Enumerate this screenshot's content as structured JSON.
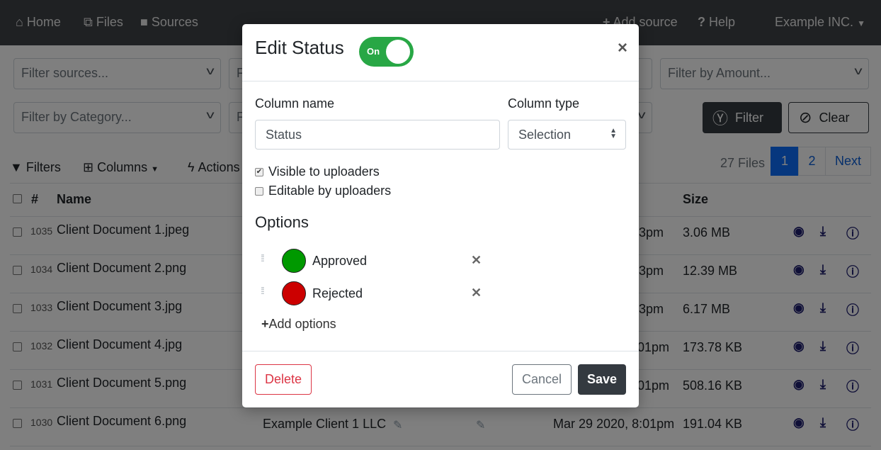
{
  "nav": {
    "home": "Home",
    "files": "Files",
    "sources": "Sources",
    "add_source": "Add source",
    "help": "Help",
    "org": "Example INC."
  },
  "filters": {
    "sources": "Filter sources...",
    "amount": "Filter by Amount...",
    "category": "Filter by Category...",
    "partial_1": "F",
    "partial_2": "F",
    "filter_btn": "Filter",
    "clear_btn": "Clear"
  },
  "toolbar": {
    "filters": "Filters",
    "columns": "Columns",
    "actions": "Actions"
  },
  "pagination": {
    "count": "27 Files",
    "pages": [
      "1",
      "2"
    ],
    "next": "Next",
    "current": 1
  },
  "table": {
    "headers": {
      "num": "#",
      "name": "Name",
      "size": "Size"
    },
    "rows": [
      {
        "id": "1035",
        "name": "Client Document 1.jpeg",
        "date": "3pm",
        "size": "3.06 MB"
      },
      {
        "id": "1034",
        "name": "Client Document 2.png",
        "date": "3pm",
        "size": "12.39 MB"
      },
      {
        "id": "1033",
        "name": "Client Document 3.jpg",
        "date": "3pm",
        "size": "6.17 MB"
      },
      {
        "id": "1032",
        "name": "Client Document 4.jpg",
        "date": ":01pm",
        "size": "173.78 KB"
      },
      {
        "id": "1031",
        "name": "Client Document 5.png",
        "date": ":01pm",
        "size": "508.16 KB"
      },
      {
        "id": "1030",
        "name": "Client Document 6.png",
        "client": "Example Client 1 LLC",
        "date": "Mar 29 2020, 8:01pm",
        "size": "191.04 KB"
      }
    ]
  },
  "modal": {
    "title": "Edit Status",
    "toggle": "On",
    "toggle_on": true,
    "column_name_label": "Column name",
    "column_name_value": "Status",
    "column_type_label": "Column type",
    "column_type_value": "Selection",
    "visible_label": "Visible to uploaders",
    "visible_checked": true,
    "editable_label": "Editable by uploaders",
    "editable_checked": false,
    "options_heading": "Options",
    "options": [
      {
        "label": "Approved",
        "color": "#009900"
      },
      {
        "label": "Rejected",
        "color": "#cc0000"
      }
    ],
    "add_options": "Add options",
    "delete": "Delete",
    "cancel": "Cancel",
    "save": "Save"
  }
}
